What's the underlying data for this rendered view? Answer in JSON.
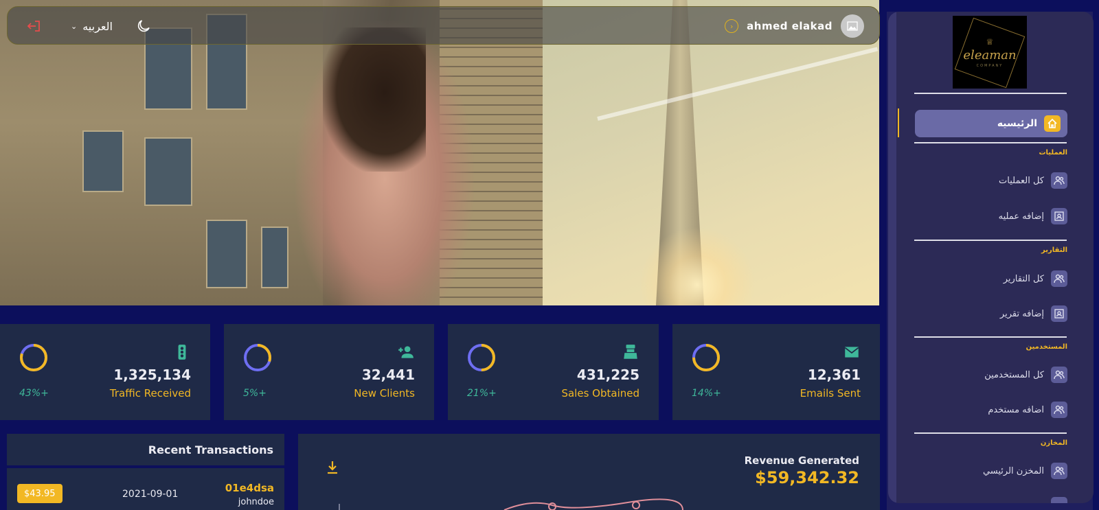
{
  "topbar": {
    "language_label": "العربيه",
    "user_name": "ahmed elakad"
  },
  "stats": [
    {
      "value": "12,361",
      "label": "Emails Sent",
      "change": "14%+",
      "progress": 0.75,
      "icon": "email-icon"
    },
    {
      "value": "431,225",
      "label": "Sales Obtained",
      "change": "21%+",
      "progress": 0.5,
      "icon": "point-of-sale-icon"
    },
    {
      "value": "32,441",
      "label": "New Clients",
      "change": "5%+",
      "progress": 0.3,
      "icon": "person-add-icon"
    },
    {
      "value": "1,325,134",
      "label": "Traffic Received",
      "change": "43%+",
      "progress": 0.8,
      "icon": "traffic-icon"
    }
  ],
  "transactions": {
    "title": "Recent Transactions",
    "rows": [
      {
        "id": "01e4dsa",
        "user": "johndoe",
        "date": "2021-09-01",
        "amount": "$43.95"
      }
    ]
  },
  "revenue": {
    "title": "Revenue Generated",
    "amount": "$59,342.32"
  },
  "sidebar": {
    "logo": {
      "brand": "eleaman",
      "sub": "COMPANY"
    },
    "home_label": "الرئيسيه",
    "sections": [
      {
        "title": "العمليات",
        "items": [
          "كل العمليات",
          "إضافه عمليه"
        ]
      },
      {
        "title": "التقارير",
        "items": [
          "كل التقارير",
          "إضافه تقرير"
        ]
      },
      {
        "title": "المستخدمين",
        "items": [
          "كل المستخدمين",
          "اضافه مستخدم"
        ]
      },
      {
        "title": "المخازن",
        "items": [
          "المخزن الرئيسي"
        ]
      }
    ]
  },
  "colors": {
    "accent": "#f2b824",
    "green": "#3fb89a",
    "ring_blue": "#6e6ef2",
    "card_bg": "#1f2a47",
    "page_bg": "#0c0f5c"
  }
}
